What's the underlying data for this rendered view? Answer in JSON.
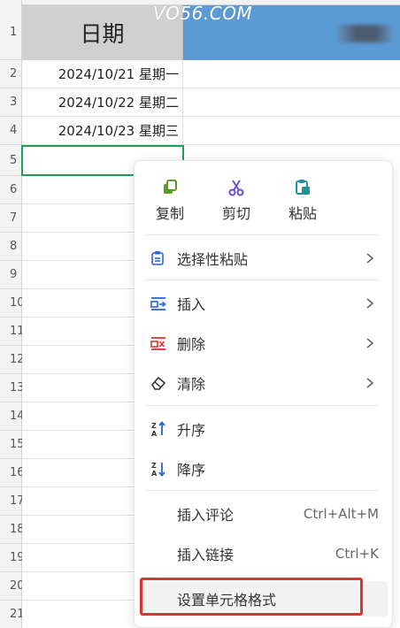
{
  "watermark": "VO56.COM",
  "sheet": {
    "header_a": "日期",
    "row_numbers": [
      "1",
      "2",
      "3",
      "4",
      "5",
      "6",
      "7",
      "8",
      "9",
      "10",
      "11",
      "12",
      "13",
      "14",
      "15",
      "16",
      "17",
      "18",
      "19",
      "20",
      "21"
    ],
    "cells": [
      "2024/10/21 星期一",
      "2024/10/22 星期二",
      "2024/10/23 星期三",
      ""
    ]
  },
  "menu": {
    "quick_actions": [
      {
        "label": "复制",
        "icon": "copy-icon",
        "color": "#5a9a1e"
      },
      {
        "label": "剪切",
        "icon": "scissors-icon",
        "color": "#6a4bd6"
      },
      {
        "label": "粘贴",
        "icon": "paste-icon",
        "color": "#1f8fa0"
      }
    ],
    "items": [
      {
        "label": "选择性粘贴",
        "icon": "paste-special-icon",
        "has_submenu": true
      },
      {
        "label": "插入",
        "icon": "insert-icon",
        "has_submenu": true
      },
      {
        "label": "删除",
        "icon": "delete-icon",
        "has_submenu": true
      },
      {
        "label": "清除",
        "icon": "eraser-icon",
        "has_submenu": true
      },
      {
        "label": "升序",
        "icon": "sort-ascending-icon"
      },
      {
        "label": "降序",
        "icon": "sort-descending-icon"
      },
      {
        "label": "插入评论",
        "shortcut": "Ctrl+Alt+M"
      },
      {
        "label": "插入链接",
        "shortcut": "Ctrl+K"
      },
      {
        "label": "设置单元格格式",
        "highlighted": true
      }
    ]
  },
  "colors": {
    "header_b": "#5b9bd5",
    "selection": "#1f9d55",
    "annotation_box": "#e03030",
    "icon_blue": "#2b63d9",
    "icon_red": "#e03030"
  }
}
